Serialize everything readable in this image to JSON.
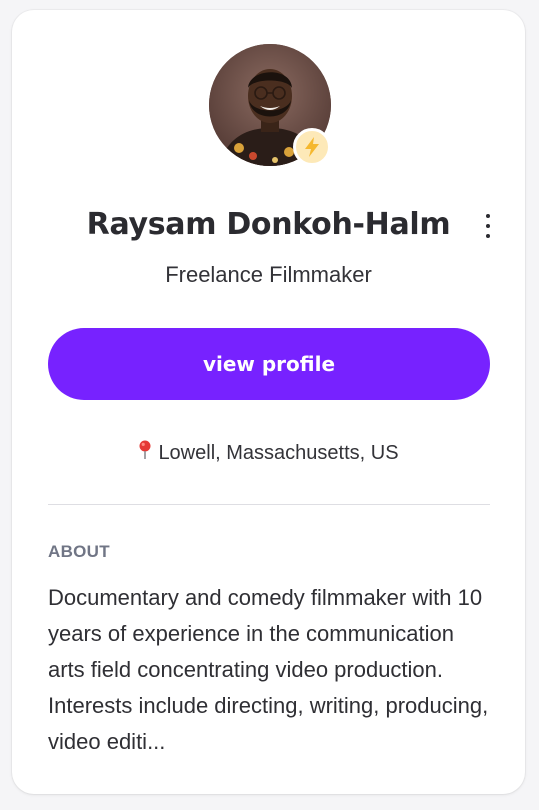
{
  "profile": {
    "name": "Raysam Donkoh-Halm",
    "title": "Freelance Filmmaker",
    "cta_label": "view profile",
    "location": "Lowell, Massachusetts, US",
    "badge_icon": "lightning-icon",
    "avatar_alt": "Profile photo"
  },
  "about": {
    "heading": "ABOUT",
    "text": "Documentary and comedy filmmaker with 10 years of experience in the communication arts field concentrating video production. Interests include directing, writing, producing, video editi..."
  },
  "colors": {
    "accent": "#7722ff",
    "badge_bg": "#fde9b8",
    "badge_bolt": "#f5b82e",
    "pin": "#e53935"
  }
}
